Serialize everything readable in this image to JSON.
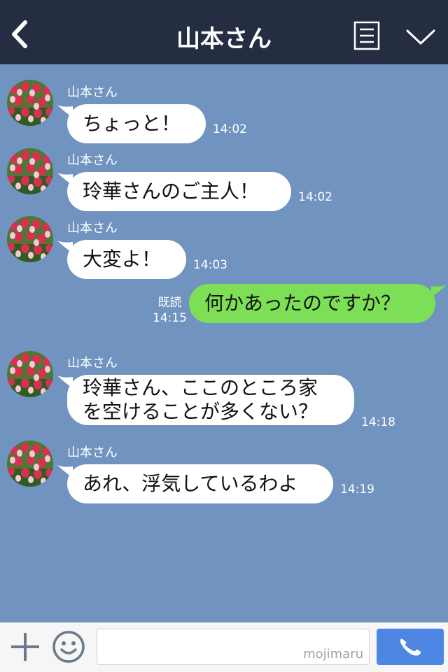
{
  "header": {
    "title": "山本さん"
  },
  "messages": [
    {
      "sender": "山本さん",
      "text": "ちょっと！",
      "time": "14:02"
    },
    {
      "sender": "山本さん",
      "text": "玲華さんのご主人！",
      "time": "14:02"
    },
    {
      "sender": "山本さん",
      "text": "大変よ！",
      "time": "14:03"
    },
    {
      "sender": "me",
      "text": "何かあったのですか？",
      "read": "既読",
      "time": "14:15"
    },
    {
      "sender": "山本さん",
      "text_line1": "玲華さん、ここのところ家",
      "text_line2": "を空けることが多くない？",
      "time": "14:18"
    },
    {
      "sender": "山本さん",
      "text": "あれ、浮気しているわよ",
      "time": "14:19"
    }
  ],
  "footer": {
    "watermark": "mojimaru"
  },
  "colors": {
    "header": "#242d42",
    "chat_bg": "#7193c0",
    "my_bubble": "#7ddf55",
    "call_button": "#4e86e4"
  },
  "icons": [
    "back-chevron-icon",
    "menu-list-icon",
    "chevron-down-icon",
    "plus-icon",
    "smiley-icon",
    "phone-icon"
  ]
}
